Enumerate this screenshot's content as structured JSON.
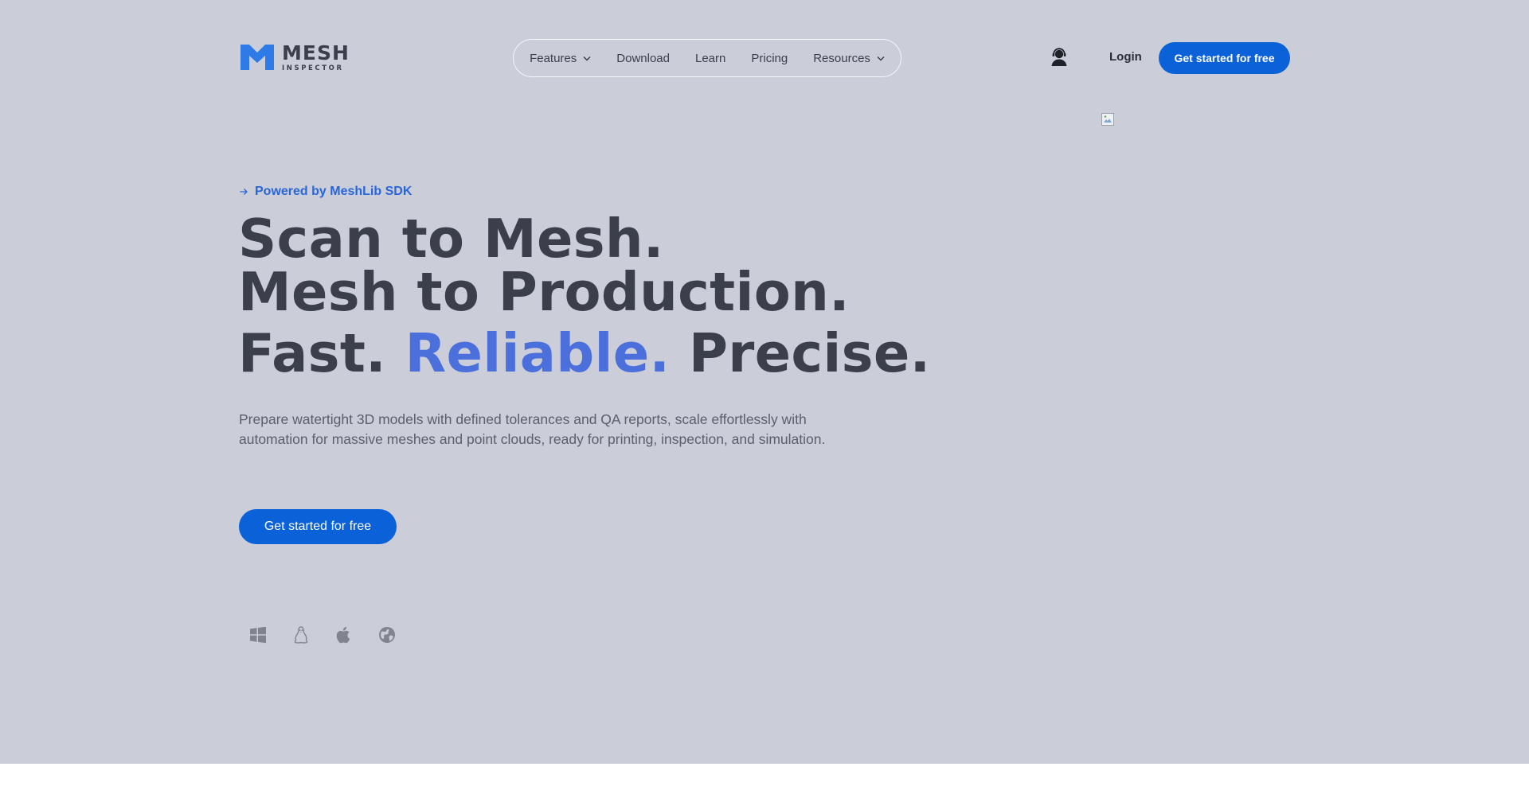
{
  "brand": {
    "name": "MESH",
    "subtitle": "INSPECTOR",
    "accent_color": "#2e7be8"
  },
  "nav": {
    "items": [
      {
        "label": "Features",
        "has_dropdown": true
      },
      {
        "label": "Download",
        "has_dropdown": false
      },
      {
        "label": "Learn",
        "has_dropdown": false
      },
      {
        "label": "Pricing",
        "has_dropdown": false
      },
      {
        "label": "Resources",
        "has_dropdown": true
      }
    ]
  },
  "header": {
    "account_icon": "user-headset-icon",
    "login_label": "Login",
    "cta_label": "Get started for free"
  },
  "hero": {
    "eyebrow": "Powered by MeshLib SDK",
    "headline": {
      "line1": "Scan to Mesh.",
      "line2": "Mesh to Production.",
      "line3_part1": "Fast.",
      "line3_accent": "Reliable.",
      "line3_part2": "Precise."
    },
    "description": "Prepare watertight 3D models with defined tolerances and QA reports, scale effortlessly with automation for massive meshes and point clouds, ready for printing, inspection, and simulation.",
    "cta_label": "Get started for free",
    "platforms": [
      "windows-icon",
      "linux-icon",
      "apple-icon",
      "web-icon"
    ]
  },
  "colors": {
    "background": "#cbcdd9",
    "primary_button": "#0b62d8",
    "text": "#3b3f4b",
    "accent_text": "#4b70dc",
    "eyebrow": "#2866d8"
  }
}
